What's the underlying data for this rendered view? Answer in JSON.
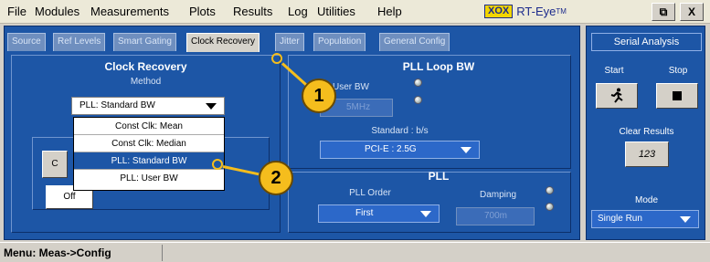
{
  "menu": [
    "File",
    "Modules",
    "Measurements",
    "Plots",
    "Results",
    "Log",
    "Utilities",
    "Help"
  ],
  "logo": {
    "box": "XOX",
    "name": "RT-Eye",
    "tm": "TM"
  },
  "window_buttons": {
    "restore": "⧉",
    "close": "X"
  },
  "tabs": [
    "Source",
    "Ref Levels",
    "Smart Gating",
    "Clock Recovery",
    "Jitter",
    "Population",
    "General Config"
  ],
  "active_tab": "Clock Recovery",
  "clock_recovery": {
    "title": "Clock Recovery",
    "method_label": "Method",
    "method_value": "PLL: Standard BW",
    "options": [
      "Const Clk: Mean",
      "Const Clk: Median",
      "PLL: Standard BW",
      "PLL: User BW"
    ],
    "selected_option": "PLL: Standard BW",
    "left_button_partial": "C",
    "off_label": "Off"
  },
  "pll_loop_bw": {
    "title": "PLL Loop BW",
    "user_bw_label": "User BW",
    "user_bw_value": "5MHz",
    "standard_label": "Standard : b/s",
    "standard_value": "PCI-E : 2.5G"
  },
  "pll": {
    "title": "PLL",
    "order_label": "PLL Order",
    "order_value": "First",
    "damping_label": "Damping",
    "damping_value": "700m"
  },
  "serial_analysis": {
    "title": "Serial Analysis",
    "start_label": "Start",
    "stop_label": "Stop",
    "clear_label": "Clear Results",
    "clear_icon_text": "123",
    "mode_label": "Mode",
    "mode_value": "Single Run"
  },
  "callouts": [
    "1",
    "2"
  ],
  "status": "Menu: Meas->Config",
  "colors": {
    "panel": "#1d56a6",
    "callout": "#f5bd1d",
    "selection": "#1d56a6"
  }
}
